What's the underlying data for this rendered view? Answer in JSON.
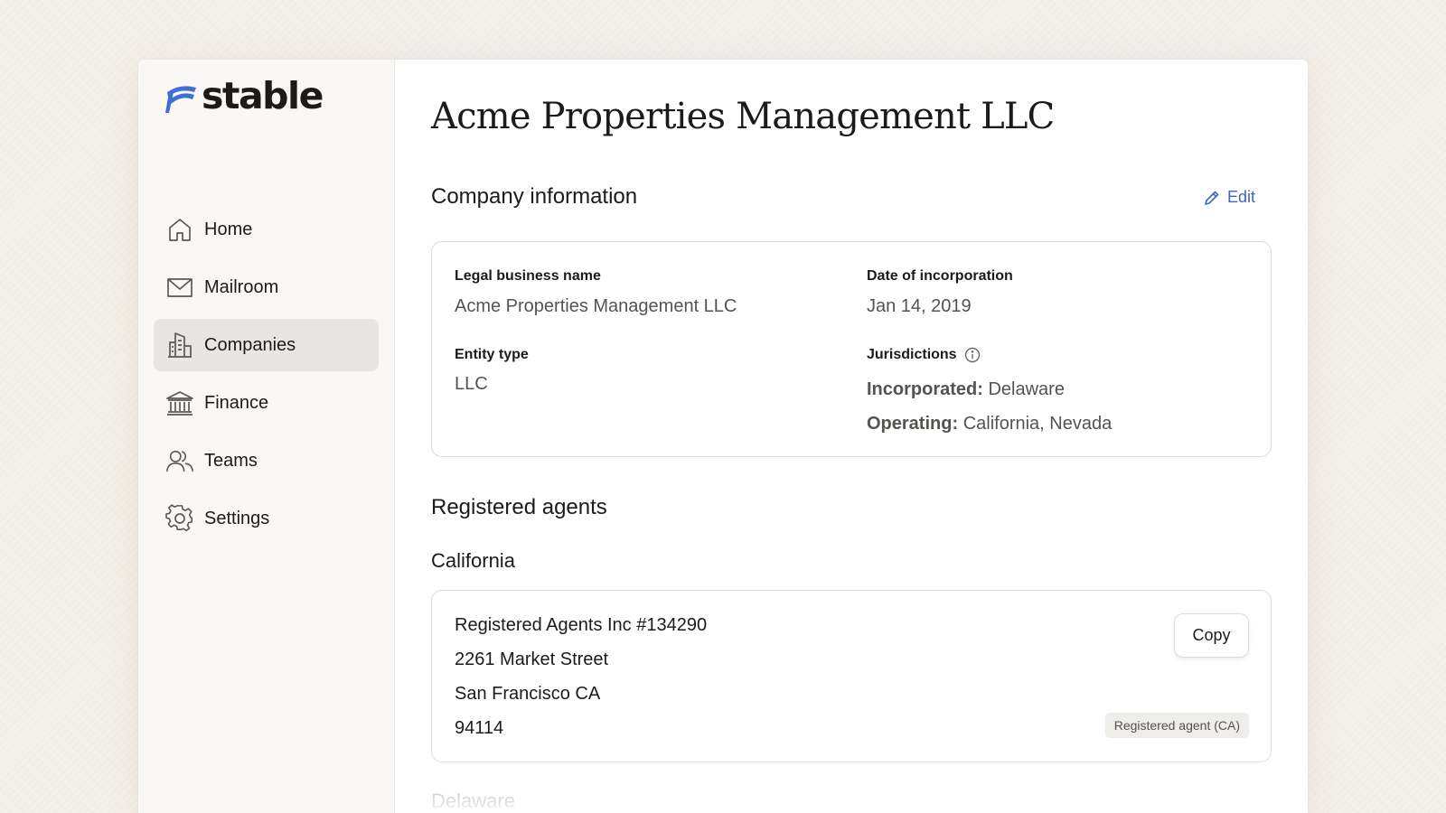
{
  "app": {
    "logo_text": "stable",
    "brand_color": "#3d6fd4"
  },
  "sidebar": {
    "items": [
      {
        "label": "Home",
        "icon": "home-icon",
        "active": false
      },
      {
        "label": "Mailroom",
        "icon": "envelope-icon",
        "active": false
      },
      {
        "label": "Companies",
        "icon": "building-icon",
        "active": true
      },
      {
        "label": "Finance",
        "icon": "bank-icon",
        "active": false
      },
      {
        "label": "Teams",
        "icon": "people-icon",
        "active": false
      },
      {
        "label": "Settings",
        "icon": "gear-icon",
        "active": false
      }
    ]
  },
  "page": {
    "title": "Acme Properties Management LLC"
  },
  "company_info": {
    "title": "Company information",
    "edit_label": "Edit",
    "legal_name_label": "Legal business name",
    "legal_name_value": "Acme Properties Management LLC",
    "date_label": "Date of incorporation",
    "date_value": "Jan 14, 2019",
    "entity_type_label": "Entity type",
    "entity_type_value": "LLC",
    "jurisdictions_label": "Jurisdictions",
    "incorporated_label": "Incorporated:",
    "incorporated_value": "Delaware",
    "operating_label": "Operating:",
    "operating_value": "California, Nevada"
  },
  "registered_agents": {
    "title": "Registered agents",
    "states": [
      {
        "name": "California",
        "agent_name": "Registered Agents Inc #134290",
        "street": "2261 Market Street",
        "city_state": "San Francisco CA",
        "zip": "94114",
        "copy_label": "Copy",
        "badge": "Registered agent (CA)"
      },
      {
        "name": "Delaware"
      }
    ]
  }
}
